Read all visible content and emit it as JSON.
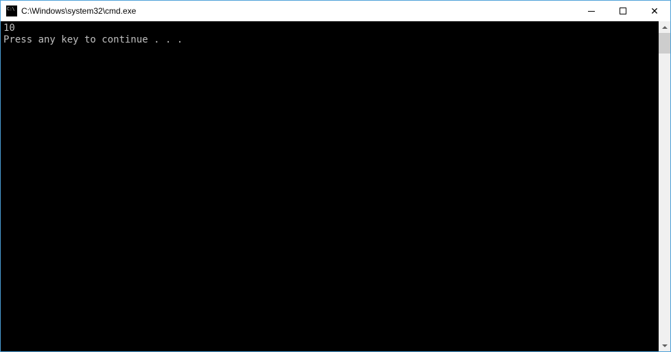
{
  "window": {
    "title": "C:\\Windows\\system32\\cmd.exe"
  },
  "console": {
    "lines": [
      "10",
      "Press any key to continue . . ."
    ]
  }
}
